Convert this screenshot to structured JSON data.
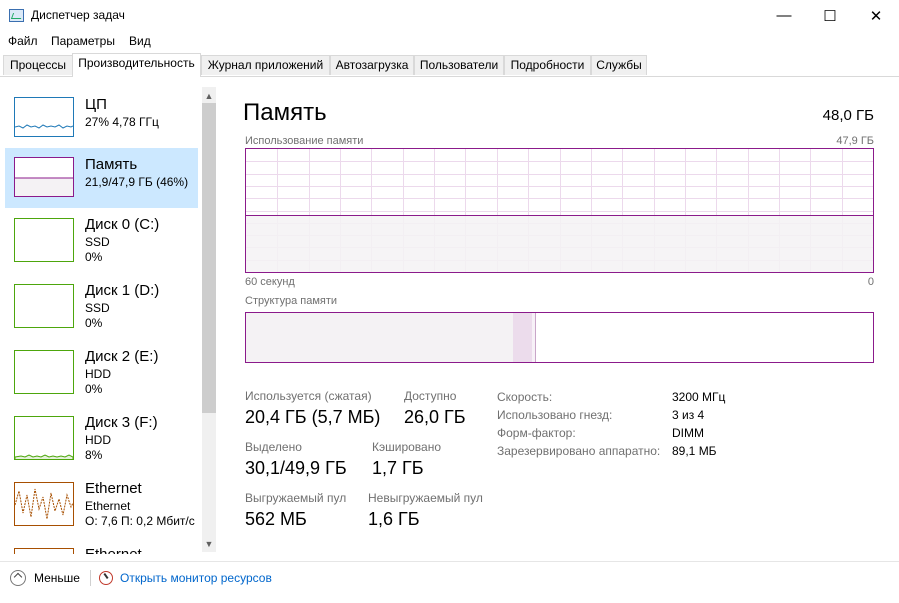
{
  "window": {
    "title": "Диспетчер задач",
    "minimize_glyph": "—",
    "maximize_glyph": "☐",
    "close_glyph": "✕"
  },
  "menu": [
    "Файл",
    "Параметры",
    "Вид"
  ],
  "tabs": [
    "Процессы",
    "Производительность",
    "Журнал приложений",
    "Автозагрузка",
    "Пользователи",
    "Подробности",
    "Службы"
  ],
  "active_tab": "Производительность",
  "sidebar": {
    "items": [
      {
        "name": "ЦП",
        "line1": "27% 4,78 ГГц",
        "line2": "",
        "color": "#1f79b7",
        "usage_percent": 27
      },
      {
        "name": "Память",
        "line1": "21,9/47,9 ГБ (46%)",
        "line2": "",
        "color": "#8b1a8b",
        "usage_percent": 46
      },
      {
        "name": "Диск 0 (C:)",
        "line1": "SSD",
        "line2": "0%",
        "color": "#4da60c",
        "usage_percent": 0
      },
      {
        "name": "Диск 1 (D:)",
        "line1": "SSD",
        "line2": "0%",
        "color": "#4da60c",
        "usage_percent": 0
      },
      {
        "name": "Диск 2 (E:)",
        "line1": "HDD",
        "line2": "0%",
        "color": "#4da60c",
        "usage_percent": 0
      },
      {
        "name": "Диск 3 (F:)",
        "line1": "HDD",
        "line2": "8%",
        "color": "#4da60c",
        "usage_percent": 8
      },
      {
        "name": "Ethernet",
        "line1": "Ethernet",
        "line2": "О: 7,6 П: 0,2 Мбит/с",
        "color": "#a74f01",
        "usage_percent": 0
      },
      {
        "name": "Ethernet",
        "line1": "",
        "line2": "",
        "color": "#a74f01",
        "usage_percent": 0
      }
    ],
    "scroll_up_glyph": "▲",
    "scroll_down_glyph": "▼"
  },
  "main": {
    "title": "Память",
    "total": "48,0 ГБ",
    "graph_label": "Использование памяти",
    "graph_max": "47,9 ГБ",
    "graph_time": "60 секунд",
    "graph_min": "0",
    "graph_usage_fraction": 0.46,
    "structure_label": "Структура памяти",
    "structure": {
      "in_use_fraction": 0.426,
      "modified_fraction": 0.03,
      "standby_fraction": 0.004
    },
    "stats": [
      {
        "label": "Используется (сжатая)",
        "value": "20,4 ГБ (5,7 МБ)"
      },
      {
        "label": "Доступно",
        "value": "26,0 ГБ"
      },
      {
        "label": "Выделено",
        "value": "30,1/49,9 ГБ"
      },
      {
        "label": "Кэшировано",
        "value": "1,7 ГБ"
      },
      {
        "label": "Выгружаемый пул",
        "value": "562 МБ"
      },
      {
        "label": "Невыгружаемый пул",
        "value": "1,6 ГБ"
      }
    ],
    "details": [
      {
        "label": "Скорость:",
        "value": "3200 МГц"
      },
      {
        "label": "Использовано гнезд:",
        "value": "3 из 4"
      },
      {
        "label": "Форм-фактор:",
        "value": "DIMM"
      },
      {
        "label": "Зарезервировано аппаратно:",
        "value": "89,1 МБ"
      }
    ]
  },
  "footer": {
    "less_label": "Меньше",
    "resmon_label": "Открыть монитор ресурсов"
  },
  "colors": {
    "memory_accent": "#8b1a8b",
    "memory_fill": "#f4f2f4",
    "selection": "#cce8ff",
    "link": "#0066cc"
  }
}
